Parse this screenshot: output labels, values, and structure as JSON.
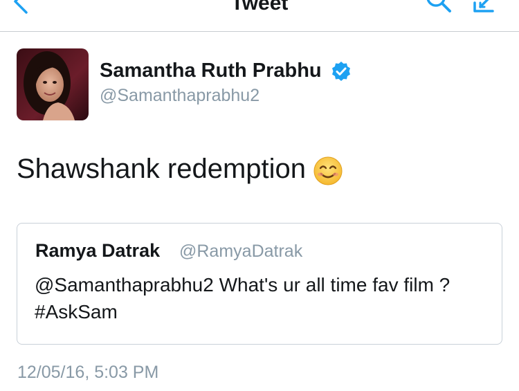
{
  "nav": {
    "title": "Tweet",
    "back_icon": "chevron-left-icon",
    "search_icon": "search-icon",
    "compose_icon": "compose-icon",
    "accent": "#1da1f2"
  },
  "tweet": {
    "author_name": "Samantha Ruth Prabhu",
    "author_handle": "@Samanthaprabhu2",
    "verified": true,
    "text": "Shawshank redemption",
    "emoji": "smiling-face-icon",
    "timestamp": "12/05/16, 5:03 PM"
  },
  "quoted": {
    "author_name": "Ramya Datrak",
    "author_handle": "@RamyaDatrak",
    "text": "@Samanthaprabhu2 What's ur all time fav film ? #AskSam"
  },
  "colors": {
    "text": "#14171a",
    "secondary": "#8899a6",
    "verified": "#1da1f2",
    "border": "#c8d0d8"
  }
}
